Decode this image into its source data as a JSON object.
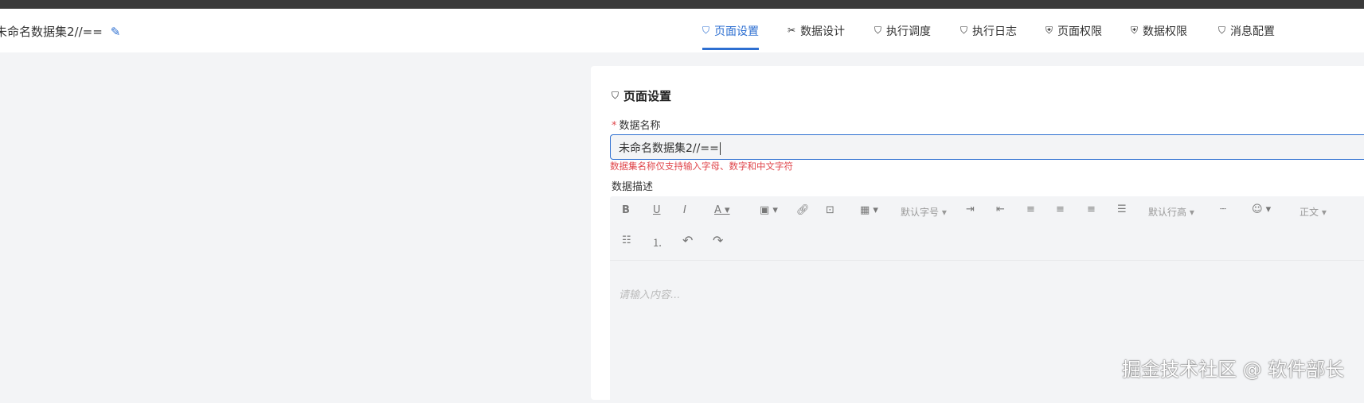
{
  "header": {
    "title": "未命名数据集2//==",
    "edit_icon": "pencil-icon"
  },
  "tabs": [
    {
      "label": "页面设置",
      "icon": "bookmark-icon",
      "active": true
    },
    {
      "label": "数据设计",
      "icon": "tools-icon"
    },
    {
      "label": "执行调度",
      "icon": "bookmark-icon"
    },
    {
      "label": "执行日志",
      "icon": "bookmark-icon"
    },
    {
      "label": "页面权限",
      "icon": "shield-icon"
    },
    {
      "label": "数据权限",
      "icon": "shield-icon"
    },
    {
      "label": "消息配置",
      "icon": "bookmark-icon"
    }
  ],
  "panel": {
    "heading": "页面设置",
    "name_label": "数据名称",
    "required_mark": "*",
    "name_value": "未命名数据集2//==",
    "name_error": "数据集名称仅支持输入字母、数字和中文字符",
    "desc_label": "数据描述",
    "desc_placeholder": "请输入内容...",
    "toolbar": {
      "font_size": "默认字号",
      "line_height": "默认行高",
      "heading": "正文"
    }
  },
  "colors": {
    "accent": "#2d6fd1",
    "error": "#e0474c"
  },
  "watermark": "掘金技术社区 @ 软件部长"
}
